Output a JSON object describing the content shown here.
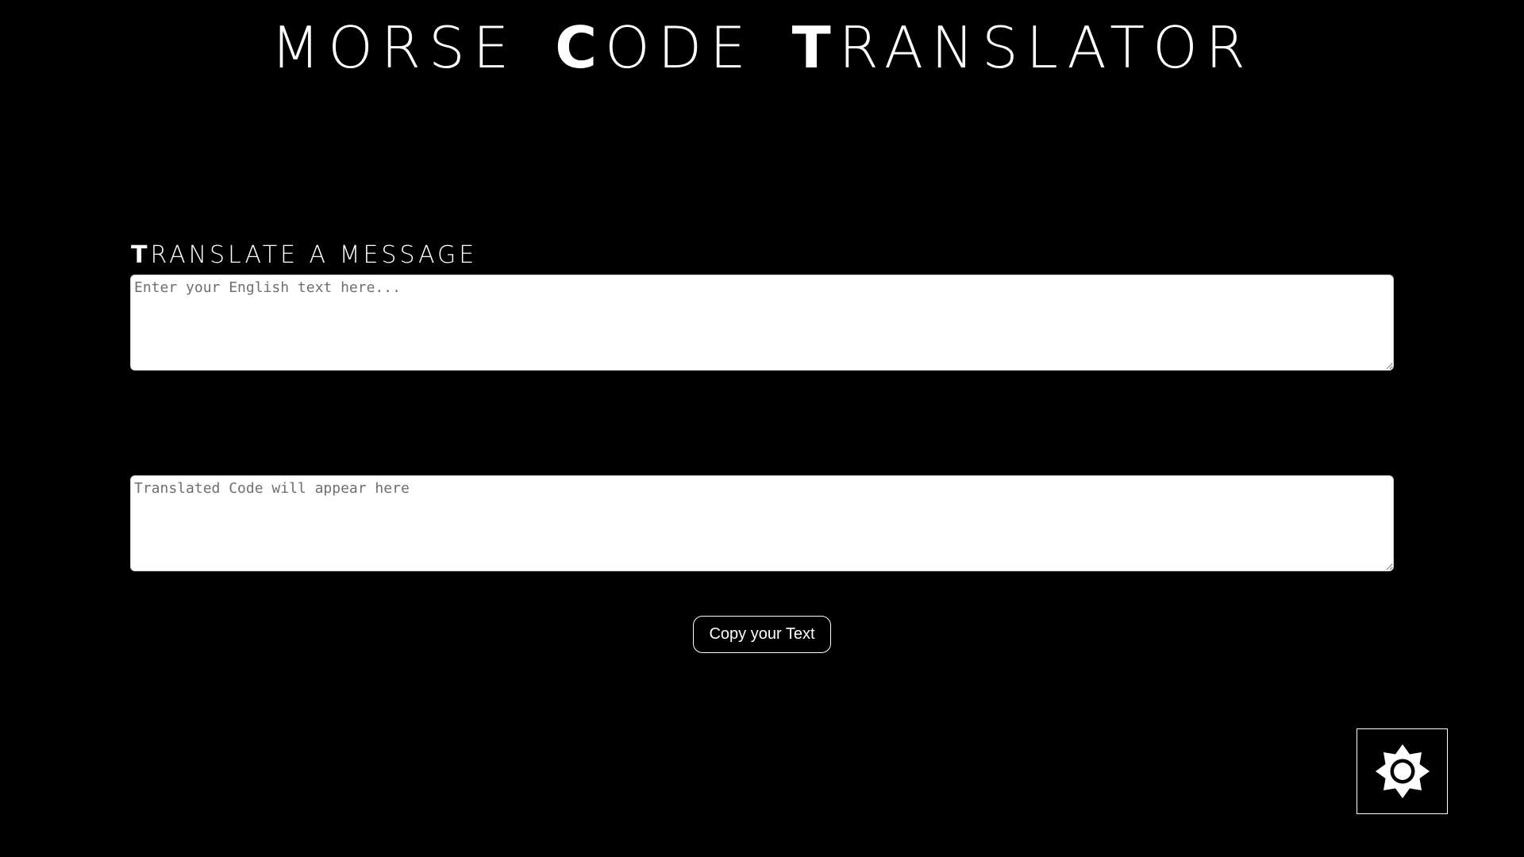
{
  "header": {
    "title_words": [
      {
        "lead": "M",
        "rest": "ORSE",
        "lead_bold": false
      },
      {
        "lead": "C",
        "rest": "ODE",
        "lead_bold": true
      },
      {
        "lead": "T",
        "rest": "RANSLATOR",
        "lead_bold": true
      }
    ]
  },
  "translate_section": {
    "heading_lead": "T",
    "heading_rest": "RANSLATE A MESSAGE"
  },
  "input": {
    "value": "",
    "placeholder": "Enter your English text here..."
  },
  "output": {
    "value": "",
    "placeholder": "Translated Code will appear here"
  },
  "copy_button": {
    "label": "Copy your Text"
  },
  "theme_toggle": {
    "icon": "sun-icon"
  },
  "colors": {
    "background": "#000000",
    "foreground": "#ffffff"
  }
}
